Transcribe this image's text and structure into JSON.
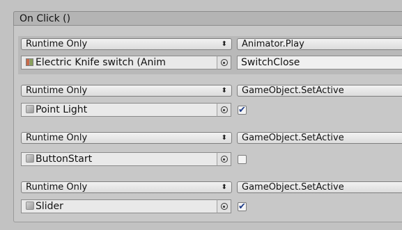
{
  "header": {
    "title": "On Click ()"
  },
  "icons": {
    "target_picker": "circle-dot-icon",
    "object_gameobject": "gameobject-cube-icon",
    "object_animator": "animator-icon",
    "dropdown_arrow": "up-down-arrows-icon",
    "checkmark": "checkmark-icon"
  },
  "arrow_glyph": "⬍",
  "entries": [
    {
      "mode": "Runtime Only",
      "function": "Animator.Play",
      "object": "Electric Knife switch (Anim",
      "param_text": "SwitchClose"
    },
    {
      "mode": "Runtime Only",
      "function": "GameObject.SetActive",
      "object": "Point Light",
      "checked": true,
      "check_glyph": "✔"
    },
    {
      "mode": "Runtime Only",
      "function": "GameObject.SetActive",
      "object": "ButtonStart",
      "checked": false,
      "check_glyph": ""
    },
    {
      "mode": "Runtime Only",
      "function": "GameObject.SetActive",
      "object": "Slider",
      "checked": true,
      "check_glyph": "✔"
    }
  ]
}
